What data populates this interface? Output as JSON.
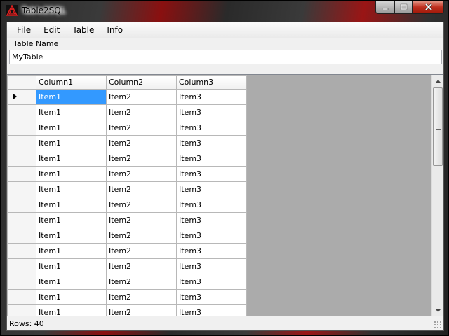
{
  "window": {
    "title": "Table2SQL"
  },
  "menu": {
    "items": [
      "File",
      "Edit",
      "Table",
      "Info"
    ]
  },
  "table_name": {
    "label": "Table Name",
    "value": "MyTable"
  },
  "grid": {
    "columns": [
      "Column1",
      "Column2",
      "Column3"
    ],
    "rows": [
      [
        "Item1",
        "Item2",
        "Item3"
      ],
      [
        "Item1",
        "Item2",
        "Item3"
      ],
      [
        "Item1",
        "Item2",
        "Item3"
      ],
      [
        "Item1",
        "Item2",
        "Item3"
      ],
      [
        "Item1",
        "Item2",
        "Item3"
      ],
      [
        "Item1",
        "Item2",
        "Item3"
      ],
      [
        "Item1",
        "Item2",
        "Item3"
      ],
      [
        "Item1",
        "Item2",
        "Item3"
      ],
      [
        "Item1",
        "Item2",
        "Item3"
      ],
      [
        "Item1",
        "Item2",
        "Item3"
      ],
      [
        "Item1",
        "Item2",
        "Item3"
      ],
      [
        "Item1",
        "Item2",
        "Item3"
      ],
      [
        "Item1",
        "Item2",
        "Item3"
      ],
      [
        "Item1",
        "Item2",
        "Item3"
      ],
      [
        "Item1",
        "Item2",
        "Item3"
      ]
    ]
  },
  "status": {
    "rows_text": "Rows: 40"
  },
  "colors": {
    "selection": "#3399ff",
    "grid_background": "#ababab",
    "close_button": "#c03020"
  }
}
